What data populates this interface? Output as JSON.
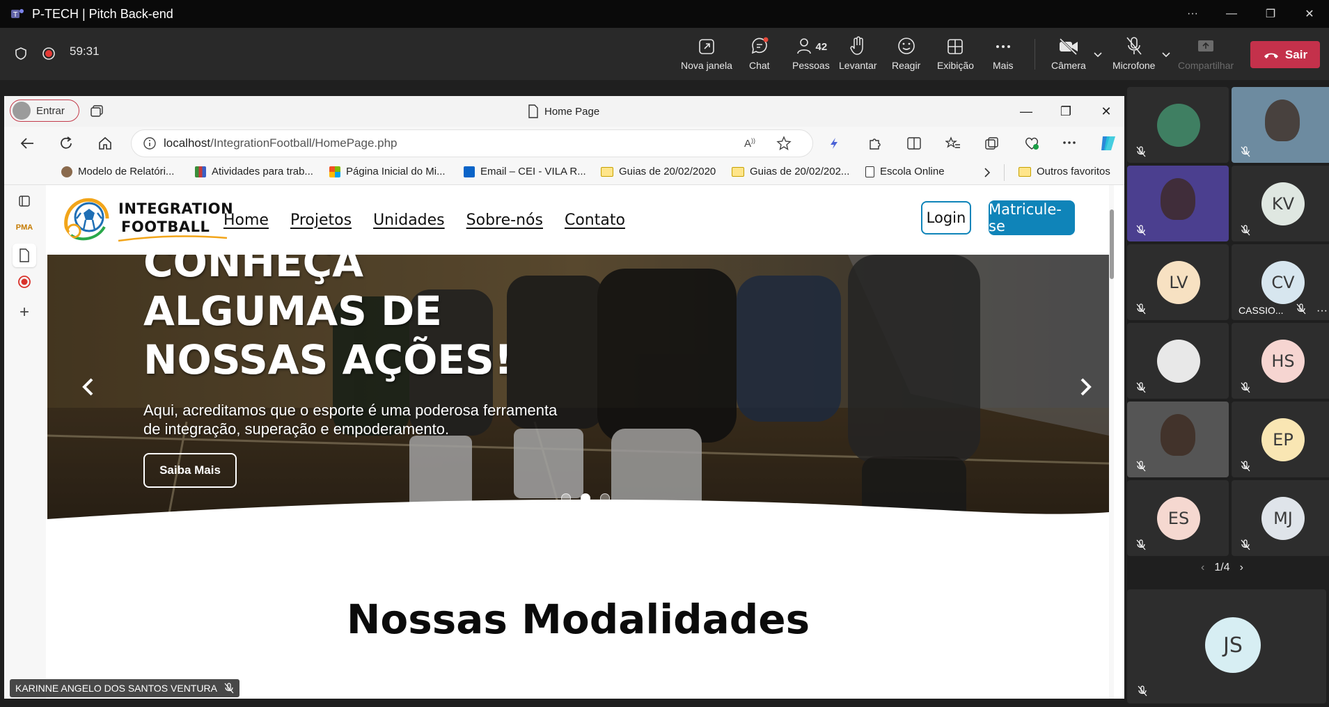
{
  "window": {
    "title": "P-TECH | Pitch Back-end",
    "min": "—",
    "restore": "❐",
    "more": "···"
  },
  "meeting": {
    "timer": "59:31",
    "buttons": {
      "new_window": "Nova janela",
      "chat": "Chat",
      "people": "Pessoas",
      "people_count": "42",
      "raise": "Levantar",
      "react": "Reagir",
      "view": "Exibição",
      "more": "Mais",
      "camera": "Câmera",
      "mic": "Microfone",
      "share": "Compartilhar",
      "leave": "Sair"
    },
    "colors": {
      "leave": "#c4314b",
      "accent": "#6264a7"
    }
  },
  "browser": {
    "profile_label": "Entrar",
    "tab_title": "Home Page",
    "url_host": "localhost",
    "url_path": "/IntegrationFootball/HomePage.php",
    "favorites": [
      {
        "label": "Modelo de Relatóri...",
        "icon": "profile-photo-icon"
      },
      {
        "label": "Atividades para trab...",
        "icon": "books-icon"
      },
      {
        "label": "Página Inicial do Mi...",
        "icon": "microsoft-logo-icon"
      },
      {
        "label": "Email – CEI - VILA R...",
        "icon": "outlook-icon"
      },
      {
        "label": "Guias de 20/02/2020",
        "icon": "folder-icon"
      },
      {
        "label": "Guias de 20/02/202...",
        "icon": "folder-icon"
      },
      {
        "label": "Escola Online",
        "icon": "page-icon"
      }
    ],
    "other_favorites": "Outros favoritos"
  },
  "site": {
    "brand_line1": "INTEGRATION",
    "brand_line2": "FOOTBALL",
    "menu": [
      "Home",
      "Projetos",
      "Unidades",
      "Sobre-nós",
      "Contato"
    ],
    "login": "Login",
    "enroll": "Matricule-se",
    "hero": {
      "line1": "CONHEÇA",
      "line2": "ALGUMAS DE",
      "line3": "NOSSAS AÇÕES!",
      "text": "Aqui, acreditamos que o esporte é uma poderosa ferramenta de integração, superação e empoderamento.",
      "button": "Saiba Mais",
      "slide_active": 2,
      "slide_count": 3
    },
    "section_title": "Nossas Modalidades",
    "accent": "#0f84b9"
  },
  "presenter_tag": "KARINNE ANGELO DOS SANTOS VENTURA",
  "participants": {
    "tiles": [
      {
        "kind": "image",
        "initials": "",
        "color": "#2d2d2d"
      },
      {
        "kind": "video",
        "initials": "",
        "color": "#6d8ba0"
      },
      {
        "kind": "video",
        "initials": "",
        "color": "#4b3f8f"
      },
      {
        "kind": "initials",
        "initials": "KV",
        "color": "#dfe7e1"
      },
      {
        "kind": "initials",
        "initials": "LV",
        "color": "#f7e1c2"
      },
      {
        "kind": "initials",
        "initials": "CV",
        "color": "#d7e6ef",
        "name": "CASSIO..."
      },
      {
        "kind": "image",
        "initials": "",
        "color": "#e8e8e8"
      },
      {
        "kind": "initials",
        "initials": "HS",
        "color": "#f6d5d1"
      },
      {
        "kind": "video",
        "initials": "",
        "color": "#555"
      },
      {
        "kind": "initials",
        "initials": "EP",
        "color": "#f9e6b3"
      },
      {
        "kind": "initials",
        "initials": "ES",
        "color": "#f5d8d0"
      },
      {
        "kind": "initials",
        "initials": "MJ",
        "color": "#dfe4ea"
      }
    ],
    "pager": "1/4",
    "bottom": {
      "initials": "JS"
    }
  }
}
